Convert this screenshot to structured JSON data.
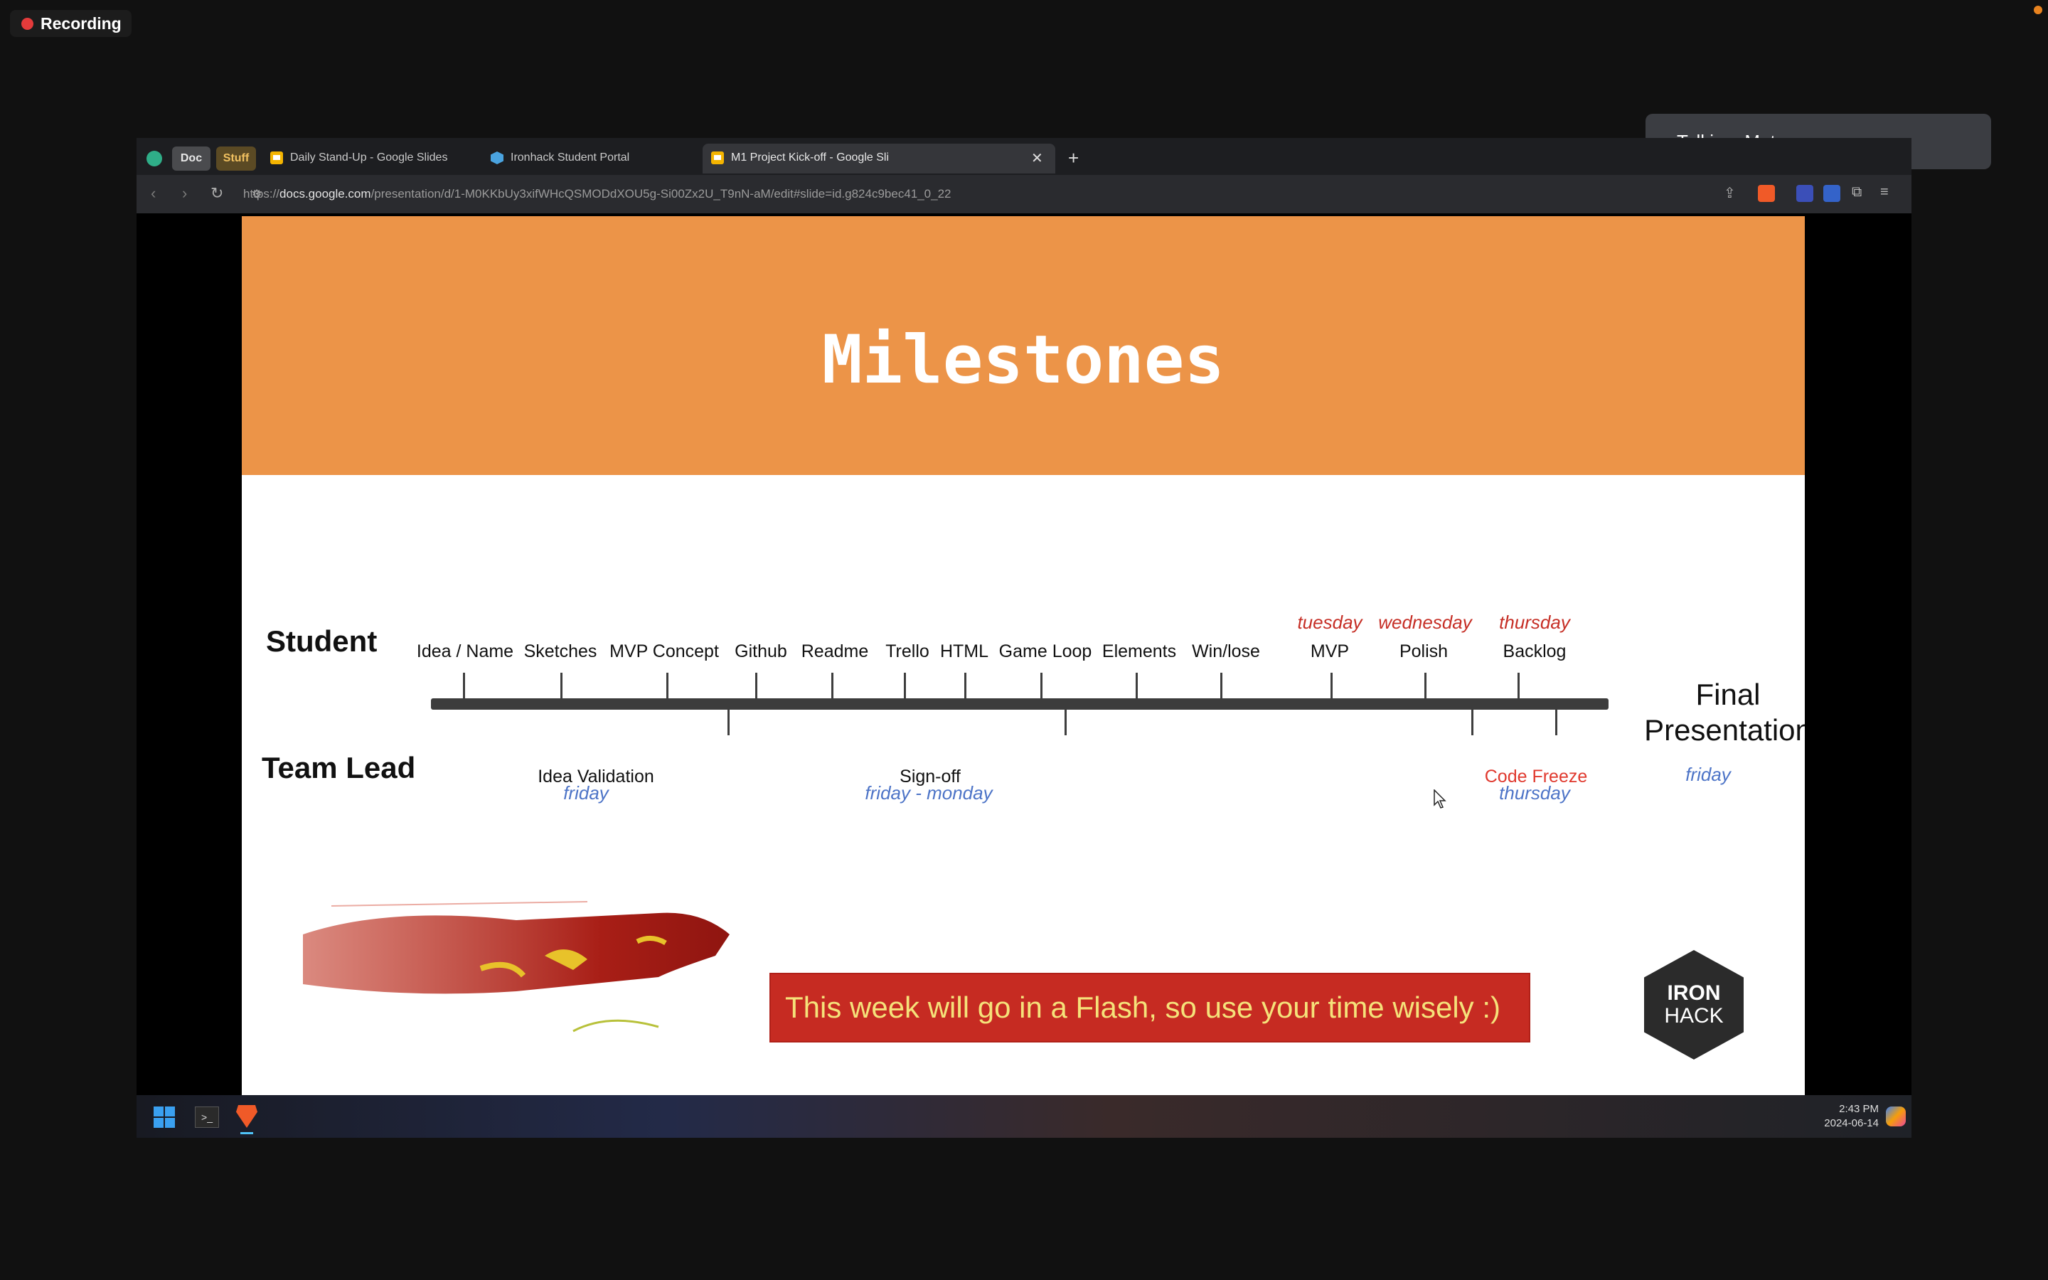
{
  "recording": {
    "label": "Recording"
  },
  "talking": {
    "label": "Talking: Mat"
  },
  "browser": {
    "group_chips": [
      "Doc",
      "Stuff"
    ],
    "tabs": [
      {
        "label": "Daily Stand-Up - Google Slides",
        "icon": "slides-icon"
      },
      {
        "label": "Ironhack Student Portal",
        "icon": "ironhack-icon"
      },
      {
        "label": "M1 Project Kick-off - Google Sli",
        "icon": "slides-icon",
        "active": true
      }
    ],
    "url_prefix": "https://",
    "url_domain": "docs.google.com",
    "url_path": "/presentation/d/1-M0KKbUy3xifWHcQSMODdXOU5g-Si00Zx2U_T9nN-aM/edit#slide=id.g824c9bec41_0_22"
  },
  "slide": {
    "title": "Milestones",
    "student_label": "Student",
    "teamlead_label": "Team Lead",
    "student_milestones": [
      "Idea / Name",
      "Sketches",
      "MVP Concept",
      "Github",
      "Readme",
      "Trello",
      "HTML",
      "Game Loop",
      "Elements",
      "Win/lose",
      "MVP",
      "Polish",
      "Backlog"
    ],
    "student_days": {
      "mvp": "tuesday",
      "polish": "wednesday",
      "backlog": "thursday"
    },
    "teamlead": {
      "idea_validation": "Idea Validation",
      "idea_validation_day": "friday",
      "signoff": "Sign-off",
      "signoff_day": "friday - monday",
      "code_freeze": "Code Freeze",
      "code_freeze_day": "thursday"
    },
    "final_line1": "Final",
    "final_line2": "Presentation",
    "final_day": "friday",
    "banner_text": "This week will go in a Flash, so use your time wisely :)",
    "logo_line1": "IRON",
    "logo_line2": "HACK"
  },
  "taskbar": {
    "time": "2:43 PM",
    "date": "2024-06-14"
  },
  "colors": {
    "banner": "#ec9448",
    "day_red": "#c62f26",
    "day_blue": "#4d74c7",
    "flash_banner": "#c62b22"
  }
}
